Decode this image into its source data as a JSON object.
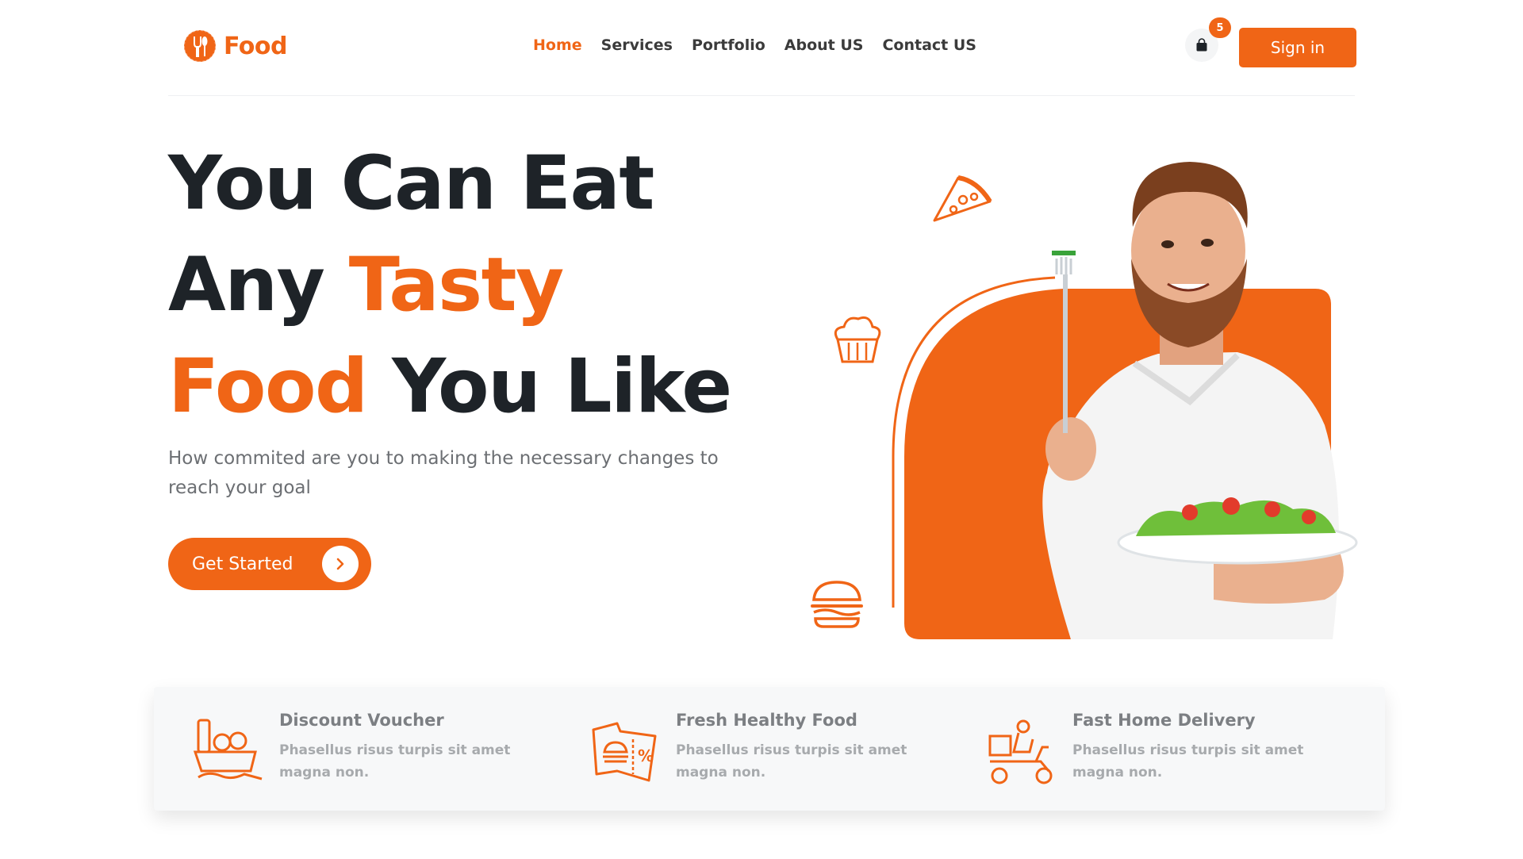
{
  "brand": {
    "name": "Food",
    "accent": "#f06516",
    "dark": "#1e2328"
  },
  "nav": [
    {
      "label": "Home",
      "active": true
    },
    {
      "label": "Services",
      "active": false
    },
    {
      "label": "Portfolio",
      "active": false
    },
    {
      "label": "About US",
      "active": false
    },
    {
      "label": "Contact US",
      "active": false
    }
  ],
  "cart": {
    "icon": "shopping-bag-icon",
    "count": "5"
  },
  "signin_label": "Sign in",
  "hero": {
    "line1": "You Can Eat",
    "line2_plain": "Any",
    "line2_highlight": "Tasty",
    "line3_highlight": "Food",
    "line3_plain": "You Like",
    "subtitle": "How commited are you to making the necessary changes to reach your goal",
    "cta_label": "Get Started",
    "cta_icon": "chevron-right-icon",
    "decor_icons": [
      "pizza-slice-icon",
      "cupcake-icon",
      "burger-icon"
    ],
    "image": "man-eating-salad-photo"
  },
  "features": [
    {
      "icon": "grocery-basket-icon",
      "title": "Discount Voucher",
      "desc": "Phasellus risus turpis sit amet magna non."
    },
    {
      "icon": "burger-voucher-icon",
      "title": "Fresh Healthy Food",
      "desc": "Phasellus risus turpis sit amet magna non."
    },
    {
      "icon": "delivery-scooter-icon",
      "title": "Fast Home Delivery",
      "desc": "Phasellus risus turpis sit amet magna non."
    }
  ]
}
